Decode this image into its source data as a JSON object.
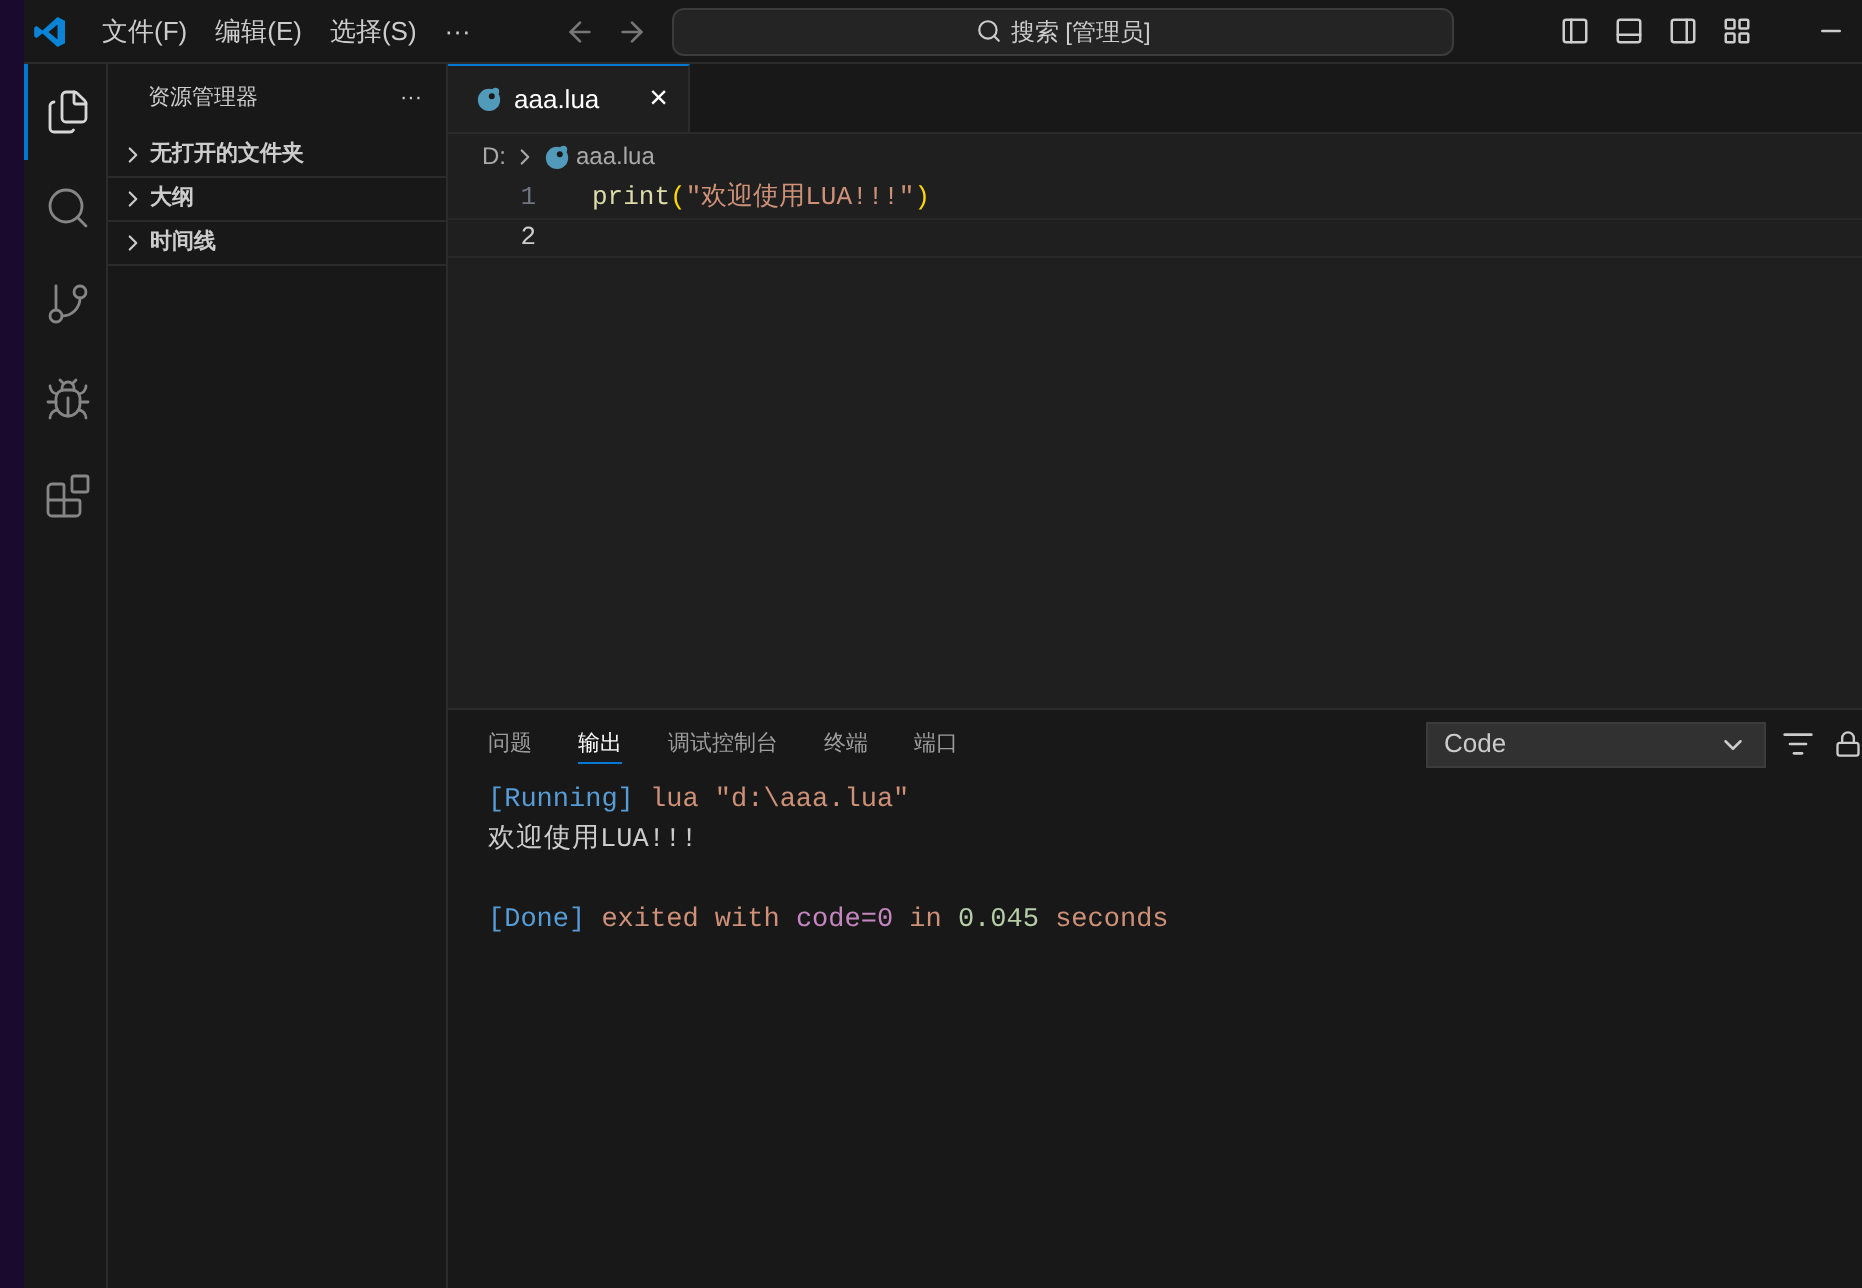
{
  "menu": [
    "文件(F)",
    "编辑(E)",
    "选择(S)",
    "···"
  ],
  "search": {
    "placeholder": "搜索 [管理员]"
  },
  "activity": [
    {
      "selected": true
    },
    {
      "selected": false
    },
    {
      "selected": false
    },
    {
      "selected": false
    },
    {
      "selected": false
    }
  ],
  "sidebar": {
    "title": "资源管理器",
    "more": "···",
    "sections": [
      {
        "label": "无打开的文件夹",
        "expanded": false
      },
      {
        "label": "大纲",
        "expanded": false
      },
      {
        "label": "时间线",
        "expanded": false
      }
    ]
  },
  "tabs": [
    {
      "label": "aaa.lua",
      "selected": true,
      "close": "×"
    }
  ],
  "breadcrumb": [
    "D:",
    "aaa.lua"
  ],
  "code": [
    {
      "number": "1",
      "tokens": [
        {
          "text": "print",
          "color": "#dcdcaa"
        },
        {
          "text": "(",
          "color": "#ffd700"
        },
        {
          "text": "\"欢迎使用LUA!!!\"",
          "color": "#ce9178"
        },
        {
          "text": ")",
          "color": "#ffd700"
        }
      ]
    },
    {
      "number": "2"
    }
  ],
  "panel": {
    "tabs": [
      {
        "label": "问题",
        "selected": false
      },
      {
        "label": "输出",
        "selected": true
      },
      {
        "label": "调试控制台",
        "selected": false
      },
      {
        "label": "终端",
        "selected": false
      },
      {
        "label": "端口",
        "selected": false
      }
    ],
    "channel": "Code",
    "output": [
      [
        {
          "text": "[Running]",
          "color": "#569cd6"
        },
        {
          "text": " lua \"d:\\aaa.lua\"",
          "color": "#ce9178"
        }
      ],
      [
        {
          "text": "欢迎使用LUA!!!",
          "color": "#cccccc"
        }
      ],
      [
        {
          "text": "[Done]",
          "color": "#569cd6"
        },
        {
          "text": " exited with ",
          "color": "#ce9178"
        },
        {
          "text": "code=0",
          "color": "#c586c0"
        },
        {
          "text": " in ",
          "color": "#ce9178"
        },
        {
          "text": "0.045",
          "color": "#b5cea8"
        },
        {
          "text": " seconds",
          "color": "#ce9178"
        }
      ]
    ]
  }
}
